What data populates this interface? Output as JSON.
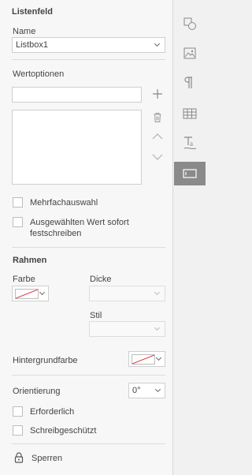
{
  "panel": {
    "title": "Listenfeld",
    "name_label": "Name",
    "name_value": "Listbox1",
    "value_options_label": "Wertoptionen",
    "value_input": "",
    "multi_select_label": "Mehrfachauswahl",
    "lock_selected_line1": "Ausgewählten Wert sofort",
    "lock_selected_line2": "festschreiben",
    "border_title": "Rahmen",
    "color_label": "Farbe",
    "thickness_label": "Dicke",
    "style_label": "Stil",
    "background_label": "Hintergrundfarbe",
    "orientation_label": "Orientierung",
    "orientation_value": "0°",
    "required_label": "Erforderlich",
    "readonly_label": "Schreibgeschützt",
    "lock_label": "Sperren"
  },
  "icons": {
    "add": "plus-icon",
    "delete": "trash-icon",
    "up": "chevron-up-icon",
    "down": "chevron-down-icon",
    "lock": "lock-icon"
  },
  "rail": [
    "shapes-icon",
    "image-icon",
    "paragraph-icon",
    "table-icon",
    "text-art-icon",
    "form-field-icon"
  ],
  "colors": {
    "accent_active": "#8a8a8a",
    "no_color_line": "#e0303a"
  }
}
